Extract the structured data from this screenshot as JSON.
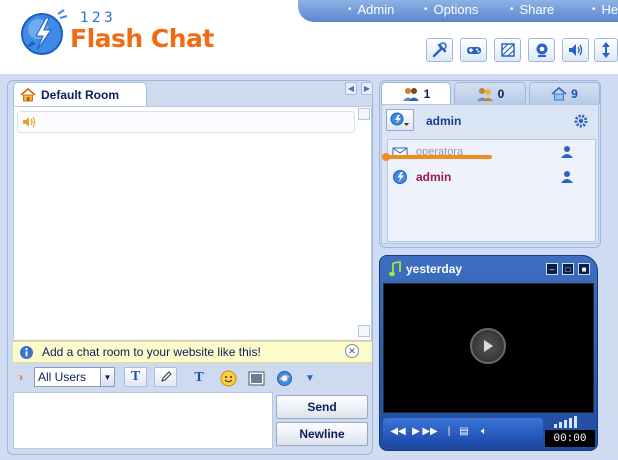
{
  "app": {
    "logo_prefix": "123",
    "logo_name": "Flash Chat"
  },
  "topnav": {
    "items": [
      "Admin",
      "Options",
      "Share",
      "He"
    ]
  },
  "toolbar": {
    "icons": [
      "tools-icon",
      "gamepad-icon",
      "skin-icon",
      "webcam-icon",
      "speaker-icon",
      "resize-icon"
    ]
  },
  "room": {
    "name": "Default Room"
  },
  "info": {
    "text": "Add a chat room to your website like this!"
  },
  "controls": {
    "recipient": "All Users",
    "text_style_label": "T",
    "font_label": "T",
    "send_label": "Send",
    "newline_label": "Newline"
  },
  "users_panel": {
    "tabs": [
      {
        "icon": "users-icon",
        "count": "1",
        "active": true
      },
      {
        "icon": "friends-icon",
        "count": "0",
        "active": false
      },
      {
        "icon": "rooms-icon",
        "count": "9",
        "active": false
      }
    ],
    "self_name": "admin",
    "users": [
      {
        "name": "operatora",
        "status": "away"
      },
      {
        "name": "admin",
        "status": "online"
      }
    ]
  },
  "player": {
    "title": "yesterday",
    "time": "00:00"
  },
  "colors": {
    "accent": "#f26b12",
    "nav": "#5a86cf",
    "panel": "#cddaf0",
    "info_bg": "#fdfbc9",
    "user_admin": "#a0165a"
  }
}
